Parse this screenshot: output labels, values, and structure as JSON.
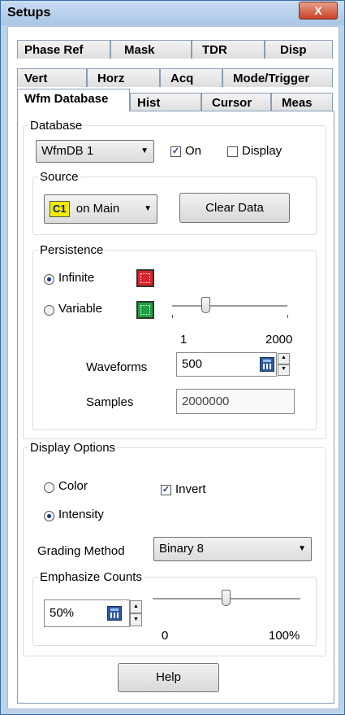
{
  "window": {
    "title": "Setups",
    "close_label": "X"
  },
  "tabs": {
    "row1": [
      "Phase Ref",
      "Mask",
      "TDR",
      "Disp"
    ],
    "row2": [
      "Vert",
      "Horz",
      "Acq",
      "Mode/Trigger"
    ],
    "row3": [
      "Wfm Database",
      "Hist",
      "Cursor",
      "Meas"
    ],
    "active": "Wfm Database"
  },
  "database": {
    "legend": "Database",
    "select_value": "WfmDB 1",
    "on_label": "On",
    "on_checked": true,
    "display_label": "Display",
    "display_checked": false
  },
  "source": {
    "legend": "Source",
    "channel_badge": "C1",
    "select_value": "on Main",
    "clear_button": "Clear Data"
  },
  "persistence": {
    "legend": "Persistence",
    "infinite_label": "Infinite",
    "variable_label": "Variable",
    "selected": "Infinite",
    "range_min": "1",
    "range_max": "2000",
    "waveforms_label": "Waveforms",
    "waveforms_value": "500",
    "samples_label": "Samples",
    "samples_value": "2000000"
  },
  "display_options": {
    "legend": "Display Options",
    "color_label": "Color",
    "intensity_label": "Intensity",
    "selected": "Intensity",
    "invert_label": "Invert",
    "invert_checked": true,
    "grading_label": "Grading Method",
    "grading_value": "Binary 8"
  },
  "emphasize": {
    "legend": "Emphasize Counts",
    "value": "50%",
    "range_min": "0",
    "range_max": "100%"
  },
  "help_button": "Help",
  "icons": {
    "infinite": "persistence-infinite-icon",
    "variable": "persistence-variable-icon",
    "calculator": "calculator-icon"
  },
  "colors": {
    "title_bar": "#b5cde9",
    "close_button": "#c8412a",
    "channel_badge": "#f2ea00",
    "infinite_icon": "#e0202a",
    "variable_icon": "#1ea040"
  }
}
